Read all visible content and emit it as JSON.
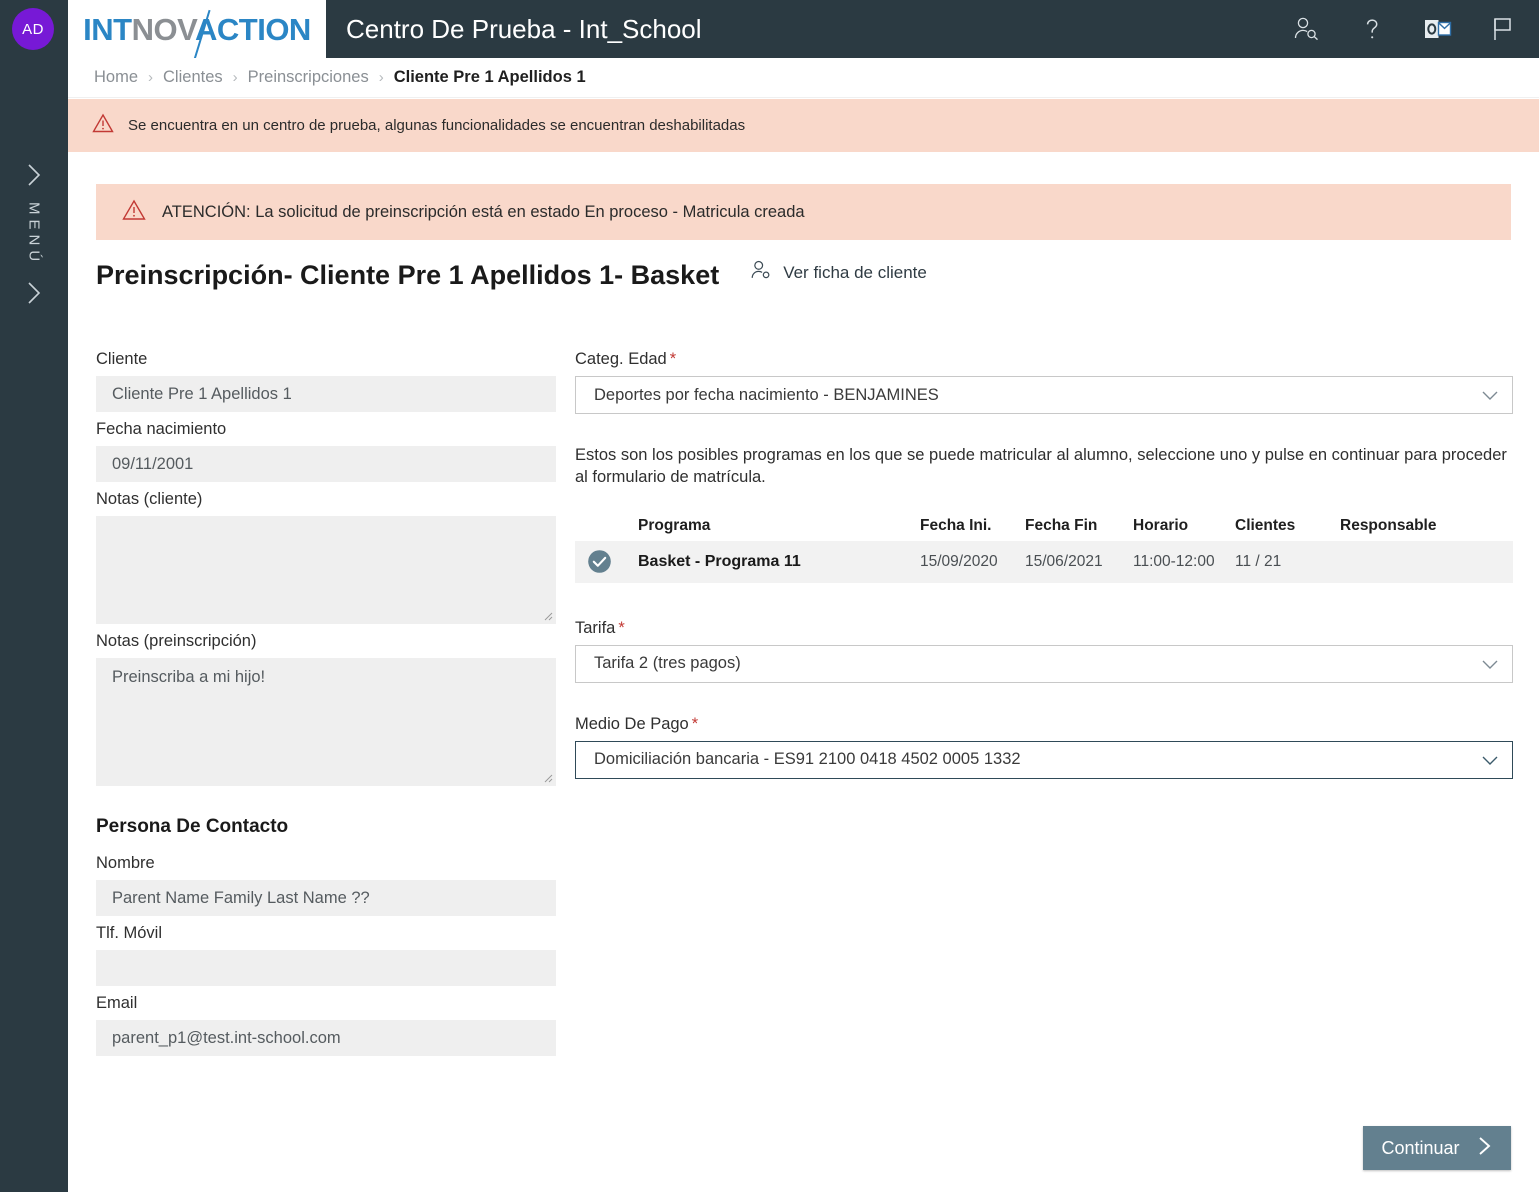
{
  "rail": {
    "avatar_initials": "AD",
    "menu_label": "MENÚ"
  },
  "topbar": {
    "logo_part1": "INT",
    "logo_part2": "NOV",
    "logo_part3": "ACTION",
    "app_title": "Centro De Prueba - Int_School",
    "icons": [
      {
        "name": "person-search-icon"
      },
      {
        "name": "help-question-icon"
      },
      {
        "name": "outlook-icon"
      },
      {
        "name": "flag-icon"
      }
    ]
  },
  "breadcrumb": {
    "items": [
      "Home",
      "Clientes",
      "Preinscripciones",
      "Cliente Pre 1 Apellidos 1"
    ],
    "separator": "›"
  },
  "warning_strip": {
    "text": "Se encuentra en un centro de prueba, algunas funcionalidades se encuentran deshabilitadas"
  },
  "notice": {
    "text": "ATENCIÓN: La solicitud de preinscripción está en estado En proceso - Matricula creada"
  },
  "page": {
    "title": "Preinscripción- Cliente Pre 1 Apellidos 1- Basket",
    "ficha_link": "Ver ficha de cliente"
  },
  "left_column": {
    "cliente": {
      "label": "Cliente",
      "value": "Cliente Pre 1 Apellidos 1"
    },
    "fecha_nacimiento": {
      "label": "Fecha nacimiento",
      "value": "09/11/2001"
    },
    "notas_cliente": {
      "label": "Notas (cliente)",
      "value": ""
    },
    "notas_preinscripcion": {
      "label": "Notas (preinscripción)",
      "value": "Preinscriba a mi hijo!"
    },
    "persona_contacto": {
      "heading": "Persona De Contacto",
      "nombre": {
        "label": "Nombre",
        "value": "Parent Name Family Last Name ??"
      },
      "telefono": {
        "label": "Tlf. Móvil",
        "value": ""
      },
      "email": {
        "label": "Email",
        "value": "parent_p1@test.int-school.com"
      }
    }
  },
  "right_column": {
    "categ_edad": {
      "label": "Categ. Edad",
      "required": "*",
      "value": "Deportes por fecha nacimiento - BENJAMINES"
    },
    "helper_text": "Estos son los posibles programas en los que se puede matricular al alumno, seleccione uno y pulse en continuar para proceder al formulario de matrícula.",
    "programs_table": {
      "columns": [
        "",
        "Programa",
        "Fecha Ini.",
        "Fecha Fin",
        "Horario",
        "Clientes",
        "Responsable"
      ],
      "rows": [
        {
          "selected": true,
          "programa": "Basket - Programa 11",
          "fecha_ini": "15/09/2020",
          "fecha_fin": "15/06/2021",
          "horario": "11:00-12:00",
          "clientes": "11 / 21",
          "responsable": ""
        }
      ]
    },
    "tarifa": {
      "label": "Tarifa",
      "required": "*",
      "value": "Tarifa 2 (tres pagos)"
    },
    "medio_pago": {
      "label": "Medio De Pago",
      "required": "*",
      "value": "Domiciliación bancaria - ES91 2100 0418 4502 0005 1332"
    }
  },
  "footer": {
    "continuar_label": "Continuar"
  },
  "colors": {
    "rail_bg": "#2b3a42",
    "avatar": "#7719d6",
    "warning_bg": "#f9d8ca",
    "warning_icon": "#c23934",
    "accent_button": "#63808f",
    "logo_blue": "#2b86c5",
    "logo_gray": "#8b8f93"
  }
}
